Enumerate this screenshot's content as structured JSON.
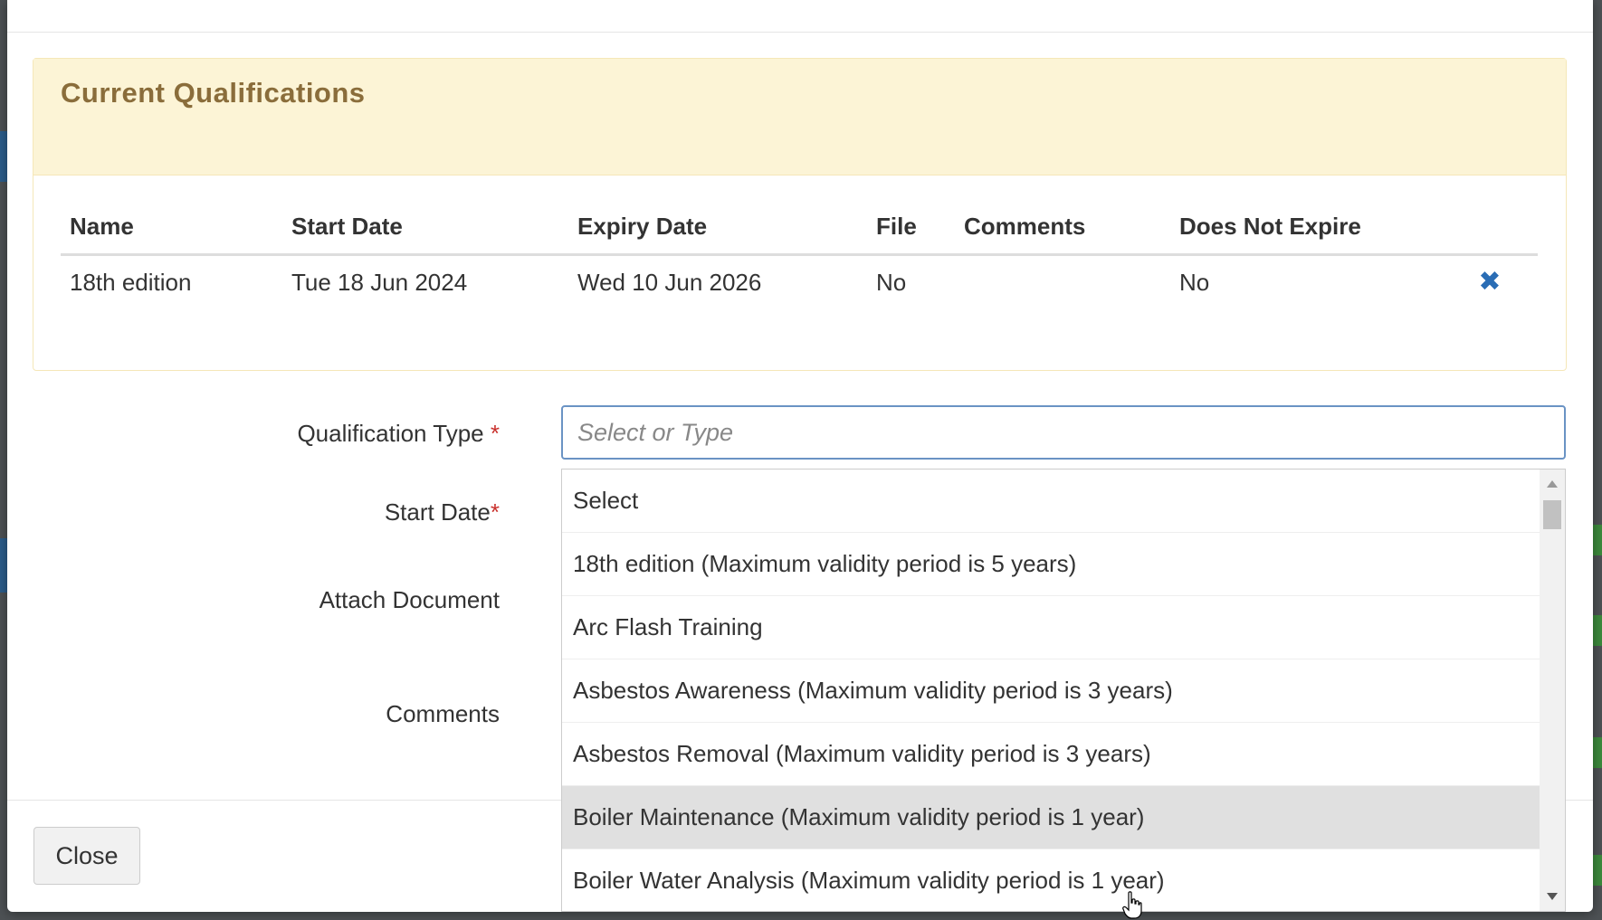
{
  "panel": {
    "title": "Current Qualifications",
    "columns": [
      "Name",
      "Start Date",
      "Expiry Date",
      "File",
      "Comments",
      "Does Not Expire"
    ],
    "rows": [
      {
        "name": "18th edition",
        "start_date": "Tue 18 Jun 2024",
        "expiry_date": "Wed 10 Jun 2026",
        "file": "No",
        "comments": "",
        "does_not_expire": "No",
        "remove_icon": "close-x-icon"
      }
    ]
  },
  "form": {
    "qualification_type_label": "Qualification Type",
    "start_date_label": "Start Date",
    "attach_document_label": "Attach Document",
    "comments_label": "Comments",
    "required_marker": "*",
    "qualification_type_placeholder": "Select or Type"
  },
  "dropdown": {
    "options": [
      "Select",
      "18th edition (Maximum validity period is 5 years)",
      "Arc Flash Training",
      "Asbestos Awareness (Maximum validity period is 3 years)",
      "Asbestos Removal (Maximum validity period is 3 years)",
      "Boiler Maintenance (Maximum validity period is 1 year)",
      "Boiler Water Analysis (Maximum validity period is 1 year)"
    ],
    "highlighted_index": 5
  },
  "footer": {
    "close_label": "Close"
  },
  "colors": {
    "panel_heading_bg": "#fcf4d6",
    "panel_title": "#8a6d3b",
    "remove_icon": "#2a6db5",
    "required": "#c9302c",
    "input_border_focus": "#6a93c4"
  }
}
